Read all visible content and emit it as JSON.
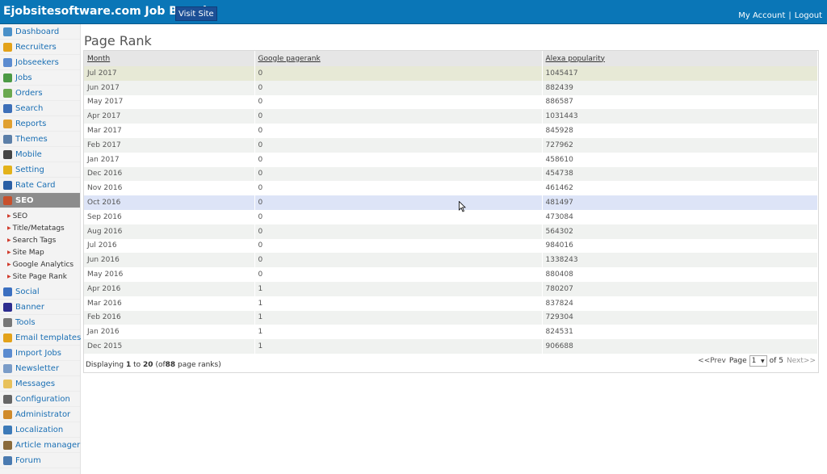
{
  "header": {
    "brand": "Ejobsitesoftware.com Job Board",
    "visit_site": "Visit Site",
    "my_account": "My Account",
    "separator": "|",
    "logout": "Logout"
  },
  "sidebar": {
    "items": [
      {
        "label": "Dashboard",
        "icon": "home-icon",
        "color": "#4a90c8"
      },
      {
        "label": "Recruiters",
        "icon": "recruiter-icon",
        "color": "#e3a21a"
      },
      {
        "label": "Jobseekers",
        "icon": "jobseekers-icon",
        "color": "#5b8bd0"
      },
      {
        "label": "Jobs",
        "icon": "jobs-icon",
        "color": "#4c9a45"
      },
      {
        "label": "Orders",
        "icon": "orders-icon",
        "color": "#6aa84f"
      },
      {
        "label": "Search",
        "icon": "search-icon",
        "color": "#3d6fb8"
      },
      {
        "label": "Reports",
        "icon": "reports-icon",
        "color": "#e0a030"
      },
      {
        "label": "Themes",
        "icon": "themes-icon",
        "color": "#5c7fa8"
      },
      {
        "label": "Mobile",
        "icon": "mobile-icon",
        "color": "#444444"
      },
      {
        "label": "Setting",
        "icon": "gear-icon",
        "color": "#e3b21a"
      },
      {
        "label": "Rate Card",
        "icon": "dollar-icon",
        "color": "#2a5fa5"
      },
      {
        "label": "SEO",
        "icon": "seo-chart-icon",
        "color": "#c8502c"
      }
    ],
    "seo_sub": [
      "SEO",
      "Title/Metatags",
      "Search Tags",
      "Site Map",
      "Google Analytics",
      "Site Page Rank"
    ],
    "items_after": [
      {
        "label": "Social",
        "icon": "social-icon",
        "color": "#3b6fc0"
      },
      {
        "label": "Banner",
        "icon": "banner-icon",
        "color": "#2d2d8f"
      },
      {
        "label": "Tools",
        "icon": "tools-icon",
        "color": "#777777"
      },
      {
        "label": "Email templates",
        "icon": "email-template-icon",
        "color": "#e3a21a"
      },
      {
        "label": "Import Jobs",
        "icon": "import-icon",
        "color": "#5b8bd0"
      },
      {
        "label": "Newsletter",
        "icon": "newsletter-icon",
        "color": "#7a9cc8"
      },
      {
        "label": "Messages",
        "icon": "messages-icon",
        "color": "#e8c15a"
      },
      {
        "label": "Configuration",
        "icon": "configuration-icon",
        "color": "#666666"
      },
      {
        "label": "Administrator",
        "icon": "administrator-icon",
        "color": "#d08a2a"
      },
      {
        "label": "Localization",
        "icon": "localization-icon",
        "color": "#3d7ab8"
      },
      {
        "label": "Article manager",
        "icon": "article-icon",
        "color": "#8a6a3a"
      },
      {
        "label": "Forum",
        "icon": "forum-icon",
        "color": "#4a7ab0"
      }
    ]
  },
  "main": {
    "title": "Page Rank",
    "columns": [
      "Month",
      "Google pagerank",
      "Alexa popularity"
    ],
    "rows": [
      [
        "Jul 2017",
        "0",
        "1045417"
      ],
      [
        "Jun 2017",
        "0",
        "882439"
      ],
      [
        "May 2017",
        "0",
        "886587"
      ],
      [
        "Apr 2017",
        "0",
        "1031443"
      ],
      [
        "Mar 2017",
        "0",
        "845928"
      ],
      [
        "Feb 2017",
        "0",
        "727962"
      ],
      [
        "Jan 2017",
        "0",
        "458610"
      ],
      [
        "Dec 2016",
        "0",
        "454738"
      ],
      [
        "Nov 2016",
        "0",
        "461462"
      ],
      [
        "Oct 2016",
        "0",
        "481497"
      ],
      [
        "Sep 2016",
        "0",
        "473084"
      ],
      [
        "Aug 2016",
        "0",
        "564302"
      ],
      [
        "Jul 2016",
        "0",
        "984016"
      ],
      [
        "Jun 2016",
        "0",
        "1338243"
      ],
      [
        "May 2016",
        "0",
        "880408"
      ],
      [
        "Apr 2016",
        "1",
        "780207"
      ],
      [
        "Mar 2016",
        "1",
        "837824"
      ],
      [
        "Feb 2016",
        "1",
        "729304"
      ],
      [
        "Jan 2016",
        "1",
        "824531"
      ],
      [
        "Dec 2015",
        "1",
        "906688"
      ]
    ],
    "footer": {
      "displaying": "Displaying",
      "from": "1",
      "to_word": "to",
      "to": "20",
      "of_open": "(of",
      "total": "88",
      "suffix": "page ranks)"
    },
    "pager": {
      "prev": "<<Prev",
      "page_label": "Page",
      "page_value": "1",
      "of_text": "of 5",
      "next": "Next>>"
    }
  }
}
